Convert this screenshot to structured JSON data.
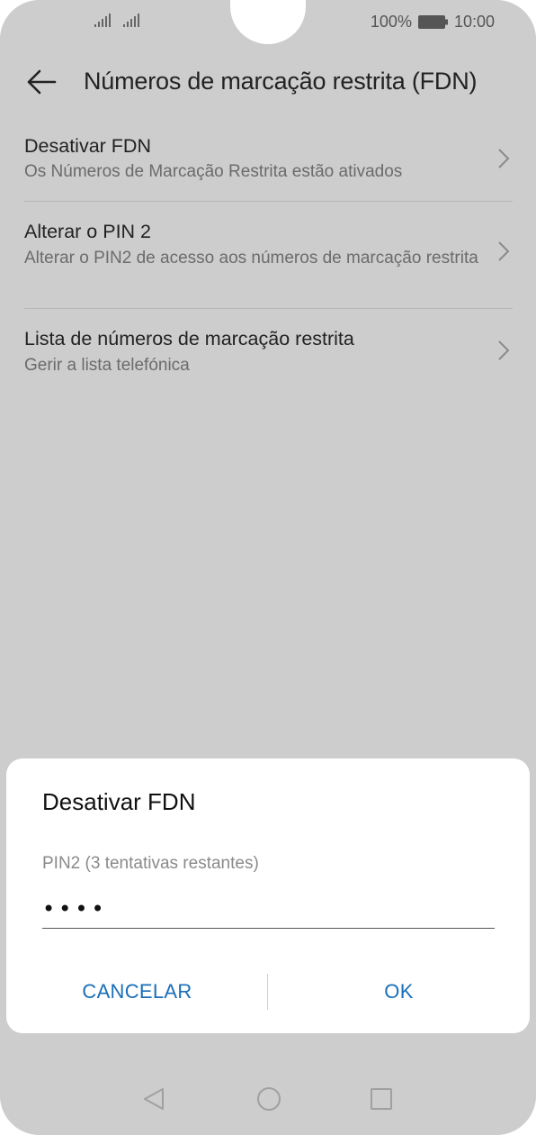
{
  "status_bar": {
    "battery_percent": "100%",
    "time": "10:00",
    "icons": [
      "signal-icon",
      "signal-icon",
      "battery-icon"
    ]
  },
  "app_bar": {
    "back_icon": "arrow-left-icon",
    "title": "Números de marcação restrita (FDN)"
  },
  "list": {
    "items": [
      {
        "title": "Desativar FDN",
        "subtitle": "Os Números de Marcação Restrita estão ativados",
        "icon": "chevron-right-icon"
      },
      {
        "title": "Alterar o PIN 2",
        "subtitle": "Alterar o PIN2 de acesso aos números de marcação restrita",
        "icon": "chevron-right-icon"
      },
      {
        "title": "Lista de números de marcação restrita",
        "subtitle": "Gerir a lista telefónica",
        "icon": "chevron-right-icon"
      }
    ]
  },
  "dialog": {
    "title": "Desativar FDN",
    "pin_label": "PIN2 (3 tentativas restantes)",
    "pin_value": "••••",
    "cancel_label": "CANCELAR",
    "ok_label": "OK"
  },
  "nav_bar": {
    "icons": [
      "nav-back-icon",
      "nav-home-icon",
      "nav-recents-icon"
    ]
  },
  "colors": {
    "scrim_background": "#cdcdcd",
    "dialog_background": "#ffffff",
    "accent": "#1a6fb8"
  }
}
